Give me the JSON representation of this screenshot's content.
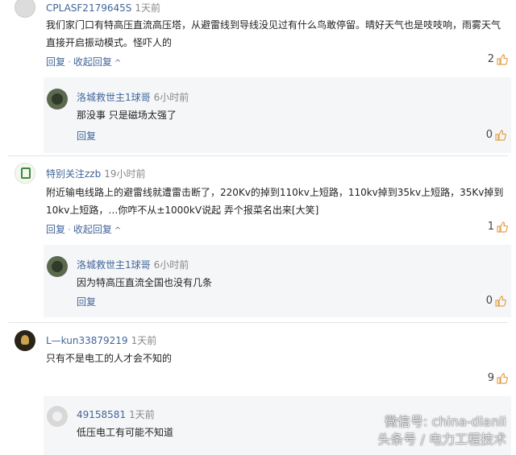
{
  "comments": [
    {
      "user": "CPLASF2179645S",
      "time": "1天前",
      "text": "我们家门口有特高压直流高压塔，从避雷线到导线没见过有什么鸟敢停留。晴好天气也是吱吱响，雨雾天气直接开启振动模式。怪吓人的",
      "reply_label": "回复",
      "collapse_label": "收起回复",
      "likes": "2",
      "replies": [
        {
          "user": "洛城救世主1球哥",
          "time": "6小时前",
          "text": "那没事 只是磁场太强了",
          "reply_label": "回复",
          "likes": "0"
        }
      ]
    },
    {
      "user": "特别关注zzb",
      "time": "19小时前",
      "text": "附近输电线路上的避雷线就遭雷击断了，220Kv的掉到110kv上短路，110kv掉到35kv上短路，35Kv掉到10kv上短路，…你咋不从±1000kV说起 弄个报菜名出来[大笑]",
      "reply_label": "回复",
      "collapse_label": "收起回复",
      "likes": "1",
      "replies": [
        {
          "user": "洛城救世主1球哥",
          "time": "6小时前",
          "text": "因为特高压直流全国也没有几条",
          "reply_label": "回复",
          "likes": "0"
        }
      ]
    },
    {
      "user": "L—kun33879219",
      "time": "1天前",
      "text": "只有不是电工的人才会不知的",
      "likes": "9",
      "replies": [
        {
          "user": "49158581",
          "time": "1天前",
          "text": "低压电工有可能不知道"
        }
      ]
    }
  ],
  "watermark": {
    "line1": "微信号: china-dianli",
    "line2": "头条号 / 电力工程技术"
  },
  "colors": {
    "link": "#406599",
    "like_icon": "#e1a24a"
  }
}
